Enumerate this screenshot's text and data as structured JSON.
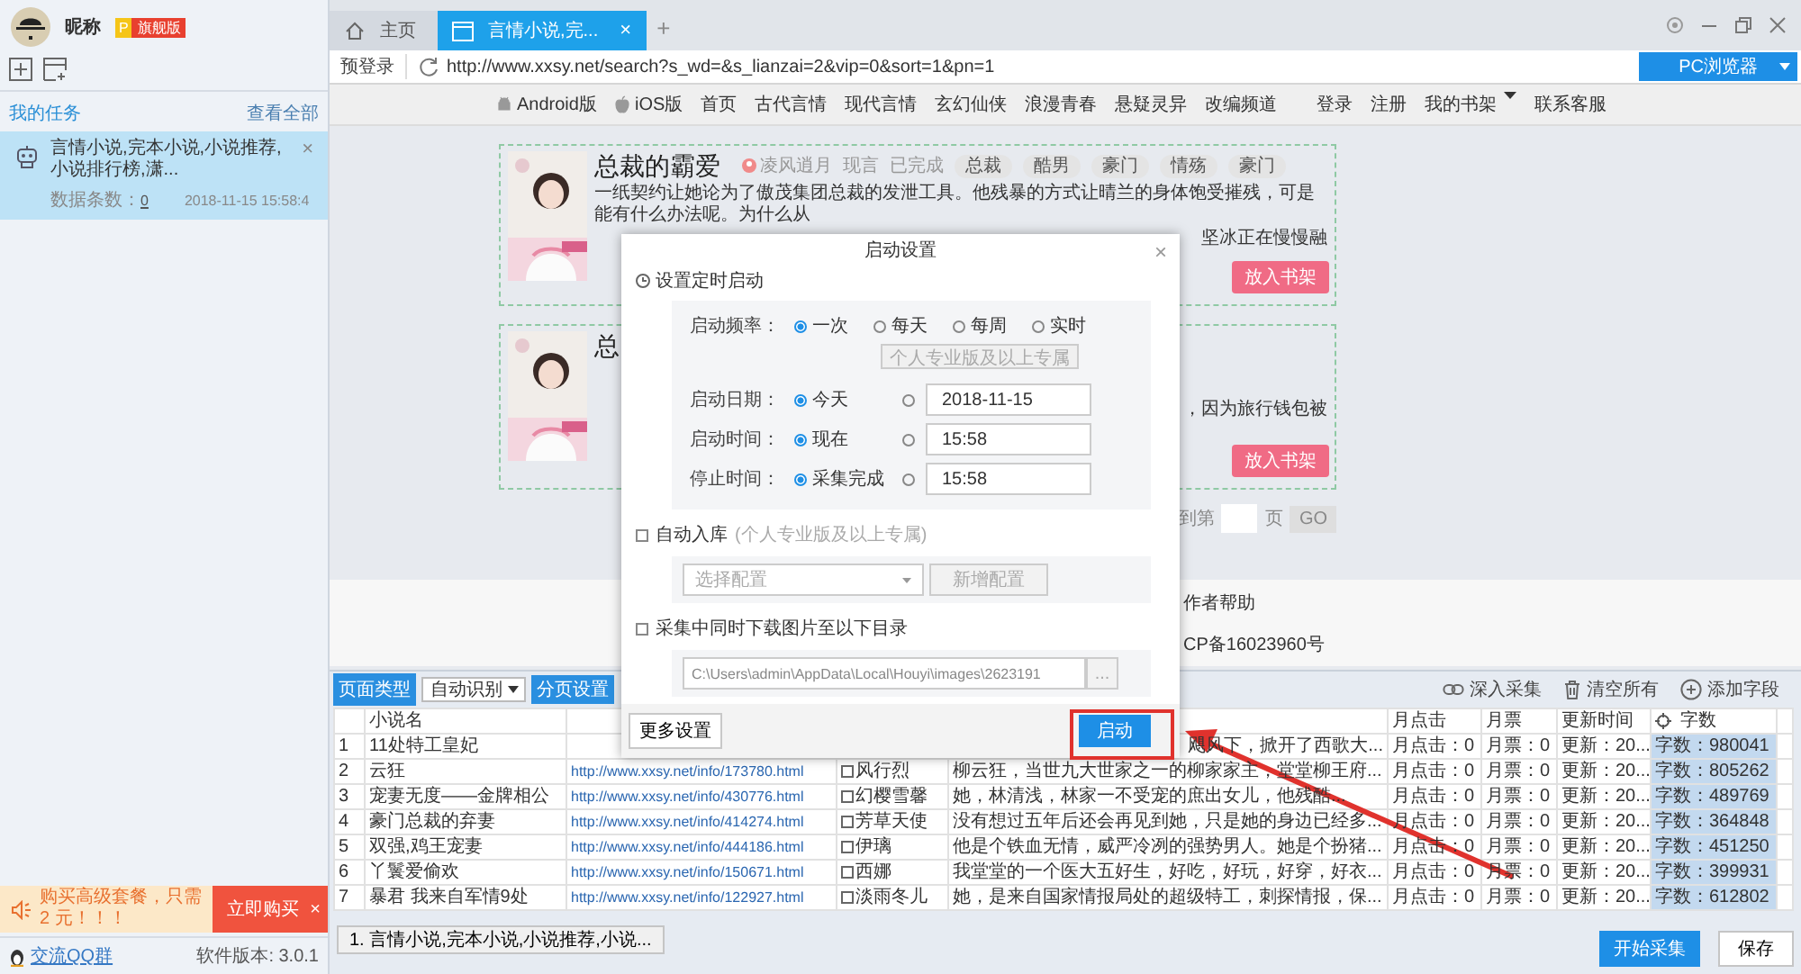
{
  "sidebar": {
    "user": {
      "name": "昵称",
      "badge_letter": "P",
      "badge": "旗舰版"
    },
    "tasks_header": {
      "title": "我的任务",
      "link": "查看全部"
    },
    "tasks": [
      {
        "title": "言情小说,完本小说,小说推荐,小说排行榜,潇...",
        "count_label": "数据条数：",
        "count": "0",
        "time": "2018-11-15 15:58:4",
        "close": "×",
        "selected": true
      }
    ],
    "promo": {
      "text": "购买高级套餐，只需 2 元！！！",
      "button": "立即购买",
      "close": "×"
    },
    "footer": {
      "link": "交流QQ群",
      "version": "软件版本: 3.0.1"
    }
  },
  "browser": {
    "tabs": [
      {
        "label": "主页",
        "selected": false
      },
      {
        "label": "言情小说,完...",
        "close": "×",
        "selected": true
      }
    ],
    "new_tab": "+",
    "address": {
      "prelogin": "预登录",
      "url": "http://www.xxsy.net/search?s_wd=&s_lianzai=2&vip=0&sort=1&pn=1",
      "browser_button": "PC浏览器"
    },
    "nav_left": [
      {
        "label": "Android版"
      },
      {
        "label": "iOS版"
      },
      {
        "label": "首页"
      },
      {
        "label": "古代言情"
      },
      {
        "label": "现代言情"
      },
      {
        "label": "玄幻仙侠"
      },
      {
        "label": "浪漫青春"
      },
      {
        "label": "悬疑灵异"
      },
      {
        "label": "改编频道"
      }
    ],
    "nav_right": [
      {
        "label": "登录"
      },
      {
        "label": "注册"
      },
      {
        "label": "我的书架",
        "caret": true
      },
      {
        "label": "联系客服"
      }
    ],
    "books": [
      {
        "title": "总裁的霸爱",
        "author": "凌风逍月",
        "genre": "现言",
        "status": "已完成",
        "tags": [
          "总裁",
          "酷男",
          "豪门",
          "情殇",
          "豪门"
        ],
        "description": "一纸契约让她论为了傲茂集团总裁的发泄工具。他残暴的方式让晴兰的身体饱受摧残，可是能有什么办法呢。为什么从",
        "fragment": "坚冰正在慢慢融",
        "button": "放入书架"
      },
      {
        "title": "总",
        "fragment": "，因为旅行钱包被",
        "button": "放入书架"
      }
    ],
    "pager": {
      "prefix": "到第",
      "suffix": "页",
      "button": "GO"
    },
    "footer": [
      "作者帮助",
      "CP备16023960号"
    ]
  },
  "collector": {
    "page_type": {
      "label": "页面类型",
      "value": "自动识别"
    },
    "paging_button": "分页设置",
    "actions": [
      {
        "label": "深入采集"
      },
      {
        "label": "清空所有"
      },
      {
        "label": "添加字段"
      }
    ],
    "table": {
      "columns": [
        {
          "kind": "index"
        },
        {
          "kind": "text",
          "label": "小说名"
        },
        {
          "kind": "link"
        },
        {
          "kind": "author"
        },
        {
          "kind": "intro"
        },
        {
          "kind": "text",
          "label": "月点击"
        },
        {
          "kind": "text",
          "label": "月票"
        },
        {
          "kind": "text",
          "label": "更新时间"
        },
        {
          "kind": "count",
          "label": "字数"
        }
      ],
      "rows": [
        {
          "cells": [
            "1",
            "11处特工皇妃",
            null,
            null,
            "飓风下，掀开了西歌大...",
            "月点击：0",
            "月票：0",
            "更新：20...",
            "字数：980041"
          ]
        },
        {
          "cells": [
            "2",
            "云狂",
            "http://www.xxsy.net/info/173780.html",
            "风行烈",
            "柳云狂，当世九大世家之一的柳家家主，堂堂柳王府...",
            "月点击：0",
            "月票：0",
            "更新：20...",
            "字数：805262"
          ]
        },
        {
          "cells": [
            "3",
            "宠妻无度——金牌相公",
            "http://www.xxsy.net/info/430776.html",
            "幻樱雪馨",
            "她，林清浅，林家一不受宠的庶出女儿，他残酷...",
            "月点击：0",
            "月票：0",
            "更新：20...",
            "字数：489769"
          ]
        },
        {
          "cells": [
            "4",
            "豪门总裁的弃妻",
            "http://www.xxsy.net/info/414274.html",
            "芳草天使",
            "没有想过五年后还会再见到她，只是她的身边已经多...",
            "月点击：0",
            "月票：0",
            "更新：20...",
            "字数：364848"
          ]
        },
        {
          "cells": [
            "5",
            "双强,鸡王宠妻",
            "http://www.xxsy.net/info/444186.html",
            "伊璃",
            "他是个铁血无情，威严冷冽的强势男人。她是个扮猪...",
            "月点击：0",
            "月票：0",
            "更新：20...",
            "字数：451250"
          ]
        },
        {
          "cells": [
            "6",
            "丫鬟爱偷欢",
            "http://www.xxsy.net/info/150671.html",
            "西娜",
            "我堂堂的一个医大五好生，好吃，好玩，好穿，好衣...",
            "月点击：0",
            "月票：0",
            "更新：20...",
            "字数：399931"
          ]
        },
        {
          "cells": [
            "7",
            "暴君 我来自军情9处",
            "http://www.xxsy.net/info/122927.html",
            "淡雨冬儿",
            "她，是来自国家情报局处的超级特工，刺探情报，保...",
            "月点击：0",
            "月票：0",
            "更新：20...",
            "字数：612802"
          ]
        }
      ]
    },
    "task_tab": "1. 言情小说,完本小说,小说推荐,小说...",
    "start": "开始采集",
    "save": "保存"
  },
  "dialog": {
    "title": "启动设置",
    "close": "×",
    "schedule_label": "设置定时启动",
    "frequency": {
      "label": "启动频率：",
      "options": [
        {
          "label": "一次",
          "selected": true
        },
        {
          "label": "每天",
          "selected": false
        },
        {
          "label": "每周",
          "selected": false
        },
        {
          "label": "实时",
          "selected": false
        }
      ],
      "pro_note": "个人专业版及以上专属"
    },
    "rows": [
      {
        "label": "启动日期：",
        "options": [
          {
            "kind": "preset",
            "label": "今天",
            "selected": true
          },
          {
            "kind": "custom",
            "value": "2018-11-15",
            "selected": false
          }
        ]
      },
      {
        "label": "启动时间：",
        "options": [
          {
            "kind": "preset",
            "label": "现在",
            "selected": true
          },
          {
            "kind": "custom",
            "value": "15:58",
            "selected": false
          }
        ]
      },
      {
        "label": "停止时间：",
        "options": [
          {
            "kind": "preset",
            "label": "采集完成",
            "selected": true
          },
          {
            "kind": "custom",
            "value": "15:58",
            "selected": false
          }
        ]
      }
    ],
    "auto_import": {
      "checked": false,
      "label": "自动入库",
      "note": "(个人专业版及以上专属)",
      "select": "选择配置",
      "button": "新增配置"
    },
    "download": {
      "checked": false,
      "label": "采集中同时下载图片至以下目录",
      "path": "C:\\Users\\admin\\AppData\\Local\\Houyi\\images\\2623191",
      "browse": "..."
    },
    "more": "更多设置",
    "start": "启动"
  }
}
